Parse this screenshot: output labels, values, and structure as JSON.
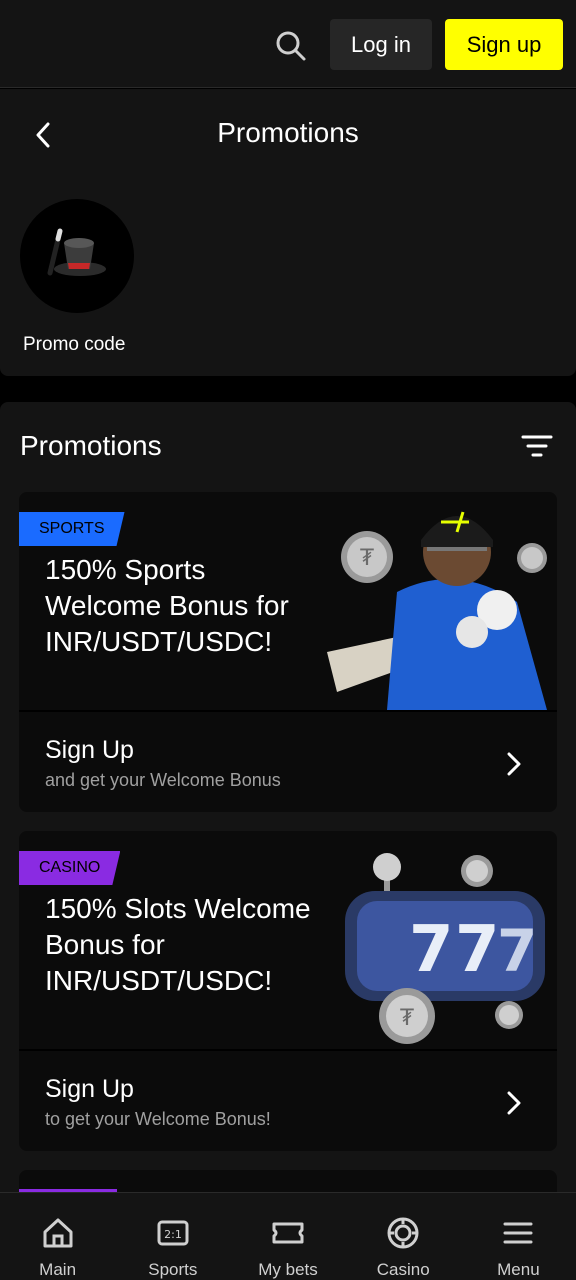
{
  "topbar": {
    "login_label": "Log in",
    "signup_label": "Sign up",
    "colors": {
      "signup_bg": "#ffff00",
      "login_bg": "#262626"
    }
  },
  "header": {
    "title": "Promotions",
    "promo_code_label": "Promo code"
  },
  "promotions": {
    "title": "Promotions",
    "cards": [
      {
        "tag": "SPORTS",
        "tag_color": "#1a6bff",
        "title": "150% Sports Welcome Bonus for INR/USDT/USDC!",
        "cta_title": "Sign Up",
        "cta_sub": "and get your Welcome Bonus"
      },
      {
        "tag": "CASINO",
        "tag_color": "#8a2be2",
        "title": "150% Slots Welcome Bonus for INR/USDT/USDC!",
        "cta_title": "Sign Up",
        "cta_sub": "to get your Welcome Bonus!"
      }
    ]
  },
  "bottom_nav": {
    "items": [
      {
        "label": "Main",
        "icon": "home-icon"
      },
      {
        "label": "Sports",
        "icon": "odds-icon"
      },
      {
        "label": "My bets",
        "icon": "ticket-icon"
      },
      {
        "label": "Casino",
        "icon": "chip-icon"
      },
      {
        "label": "Menu",
        "icon": "hamburger-icon"
      }
    ]
  }
}
